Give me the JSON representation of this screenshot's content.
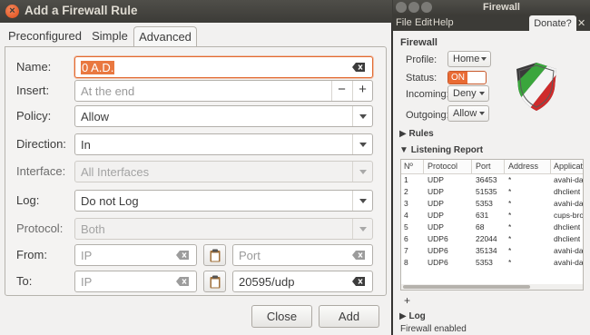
{
  "dialog": {
    "title": "Add a Firewall Rule",
    "tabs": [
      "Preconfigured",
      "Simple",
      "Advanced"
    ],
    "active_tab": "Advanced",
    "fields": {
      "name": {
        "label": "Name:",
        "value": "0 A.D."
      },
      "insert": {
        "label": "Insert:",
        "placeholder": "At the end",
        "minus": "−",
        "plus": "+"
      },
      "policy": {
        "label": "Policy:",
        "value": "Allow"
      },
      "direction": {
        "label": "Direction:",
        "value": "In"
      },
      "interface": {
        "label": "Interface:",
        "value": "All Interfaces"
      },
      "log": {
        "label": "Log:",
        "value": "Do not Log"
      },
      "protocol": {
        "label": "Protocol:",
        "value": "Both"
      },
      "from": {
        "label": "From:",
        "ip_placeholder": "IP",
        "port_placeholder": "Port"
      },
      "to": {
        "label": "To:",
        "ip_placeholder": "IP",
        "port_value": "20595/udp"
      }
    },
    "buttons": {
      "close": "Close",
      "add": "Add"
    }
  },
  "firewall": {
    "title": "Firewall",
    "menu": [
      "File",
      "Edit",
      "Help"
    ],
    "donate": "Donate?",
    "donate_close": "✕",
    "section_title": "Firewall",
    "profile": {
      "label": "Profile:",
      "value": "Home"
    },
    "status": {
      "label": "Status:",
      "value": "ON"
    },
    "incoming": {
      "label": "Incoming:",
      "value": "Deny"
    },
    "outgoing": {
      "label": "Outgoing:",
      "value": "Allow"
    },
    "rules_label": "Rules",
    "listening_label": "Listening Report",
    "columns": [
      "Nº",
      "Protocol",
      "Port",
      "Address",
      "Applicat"
    ],
    "rows": [
      [
        "1",
        "UDP",
        "36453",
        "*",
        "avahi-da"
      ],
      [
        "2",
        "UDP",
        "51535",
        "*",
        "dhclient"
      ],
      [
        "3",
        "UDP",
        "5353",
        "*",
        "avahi-da"
      ],
      [
        "4",
        "UDP",
        "631",
        "*",
        "cups-bro"
      ],
      [
        "5",
        "UDP",
        "68",
        "*",
        "dhclient"
      ],
      [
        "6",
        "UDP6",
        "22044",
        "*",
        "dhclient"
      ],
      [
        "7",
        "UDP6",
        "35134",
        "*",
        "avahi-da"
      ],
      [
        "8",
        "UDP6",
        "5353",
        "*",
        "avahi-da"
      ]
    ],
    "add_symbol": "+",
    "log_label": "Log",
    "statusbar": "Firewall enabled",
    "colors": {
      "accent": "#e96b34",
      "titlebar": "#3c3b37"
    }
  }
}
